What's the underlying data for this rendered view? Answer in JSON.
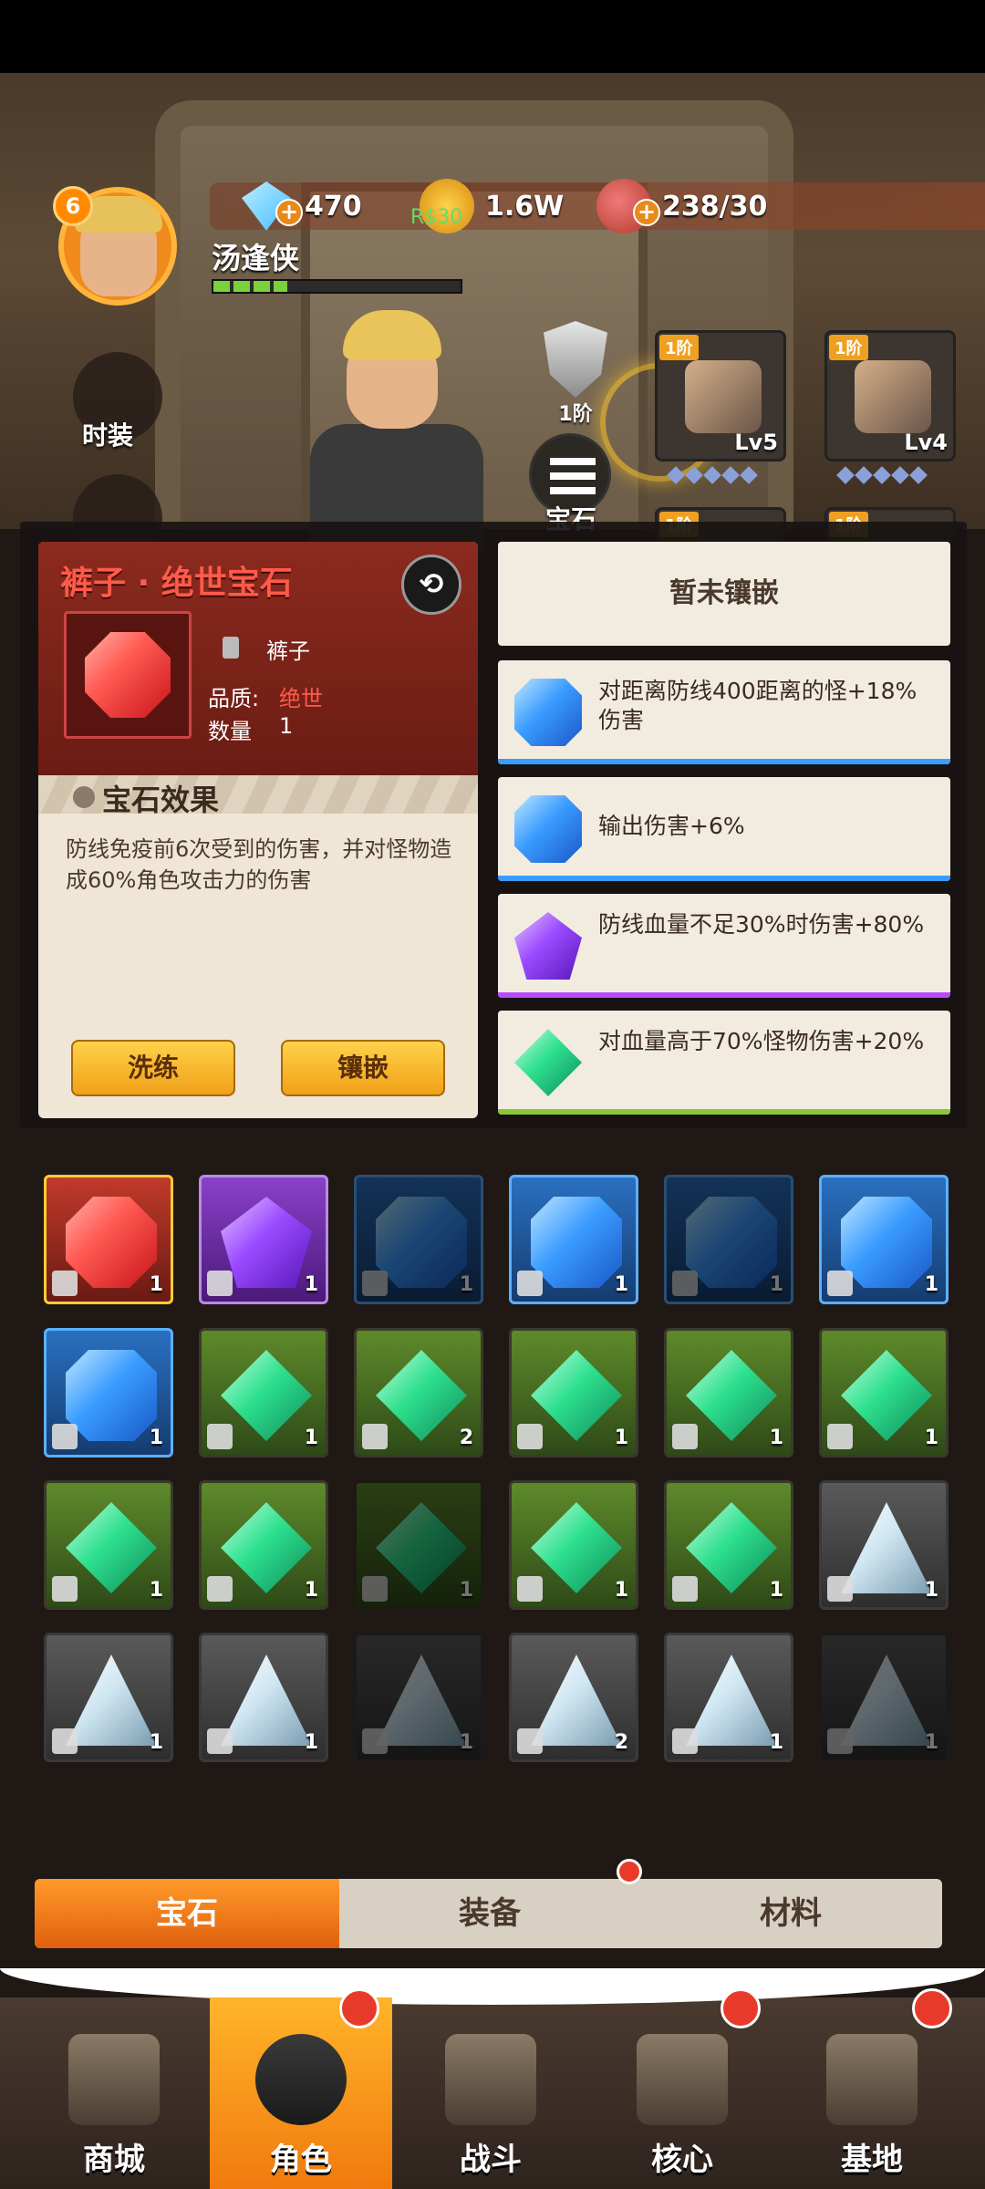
{
  "player": {
    "level": "6",
    "name": "汤逢侠"
  },
  "resources": {
    "diamonds": "470",
    "coins": "1.6W",
    "coins_overlay": "R$30",
    "stamina": "238/30"
  },
  "side_menu": {
    "costume_label": "时装"
  },
  "equipment": {
    "shield_tier": "1阶",
    "gem_slot_label": "宝石",
    "slots": [
      {
        "tier": "1阶",
        "level": "Lv5"
      },
      {
        "tier": "1阶",
        "level": "Lv4"
      },
      {
        "tier": "1阶"
      },
      {
        "tier": "1阶"
      }
    ]
  },
  "detail": {
    "title": "裤子 · 绝世宝石",
    "slot_name": "裤子",
    "quality_label": "品质:",
    "quality_value": "绝世",
    "quantity_label": "数量",
    "quantity_value": "1",
    "effect_title": "宝石效果",
    "effect_desc": "防线免疫前6次受到的伤害，并对怪物造成60%角色攻击力的伤害",
    "btn_refine": "洗练",
    "btn_inlay": "镶嵌"
  },
  "sockets": {
    "empty_text": "暂未镶嵌",
    "items": [
      {
        "color": "blue",
        "text": "对距离防线400距离的怪+18%伤害"
      },
      {
        "color": "blue",
        "text": "输出伤害+6%"
      },
      {
        "color": "purple",
        "text": "防线血量不足30%时伤害+80%"
      },
      {
        "color": "green",
        "text": "对血量高于70%怪物伤害+20%"
      }
    ]
  },
  "inventory": [
    {
      "gem": "red",
      "bg": "red",
      "count": "1"
    },
    {
      "gem": "purple",
      "bg": "purple",
      "count": "1"
    },
    {
      "gem": "blue",
      "bg": "blue",
      "count": "1",
      "dim": true
    },
    {
      "gem": "blue",
      "bg": "blue",
      "count": "1"
    },
    {
      "gem": "blue",
      "bg": "blue",
      "count": "1",
      "dim": true
    },
    {
      "gem": "blue",
      "bg": "blue",
      "count": "1"
    },
    {
      "gem": "blue",
      "bg": "blue",
      "count": "1"
    },
    {
      "gem": "green",
      "bg": "green",
      "count": "1"
    },
    {
      "gem": "green",
      "bg": "green",
      "count": "2"
    },
    {
      "gem": "green",
      "bg": "green",
      "count": "1"
    },
    {
      "gem": "green",
      "bg": "green",
      "count": "1"
    },
    {
      "gem": "green",
      "bg": "green",
      "count": "1"
    },
    {
      "gem": "green",
      "bg": "green",
      "count": "1"
    },
    {
      "gem": "green",
      "bg": "green",
      "count": "1"
    },
    {
      "gem": "green",
      "bg": "green",
      "count": "1",
      "dim": true
    },
    {
      "gem": "green",
      "bg": "green",
      "count": "1"
    },
    {
      "gem": "green",
      "bg": "green",
      "count": "1"
    },
    {
      "gem": "white",
      "bg": "gray",
      "count": "1"
    },
    {
      "gem": "white",
      "bg": "gray",
      "count": "1"
    },
    {
      "gem": "white",
      "bg": "gray",
      "count": "1"
    },
    {
      "gem": "white",
      "bg": "gray",
      "count": "1",
      "dim": true
    },
    {
      "gem": "white",
      "bg": "gray",
      "count": "2"
    },
    {
      "gem": "white",
      "bg": "gray",
      "count": "1"
    },
    {
      "gem": "white",
      "bg": "gray",
      "count": "1",
      "dim": true
    }
  ],
  "tabs": {
    "gems": "宝石",
    "equipment": "装备",
    "materials": "材料"
  },
  "bottom_nav": {
    "shop": "商城",
    "character": "角色",
    "battle": "战斗",
    "core": "核心",
    "base": "基地"
  },
  "colors": {
    "accent_orange": "#f07a0e",
    "legendary_red": "#ff5a4a",
    "gem_blue": "#3a9cff",
    "gem_purple": "#9a4aff",
    "gem_green": "#2ee08e"
  }
}
